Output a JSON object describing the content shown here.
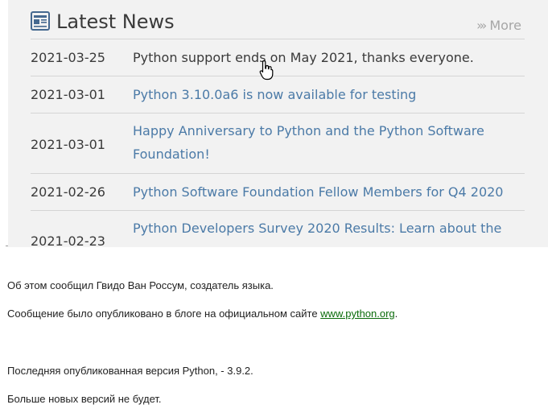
{
  "news": {
    "title": "Latest News",
    "more_label": "More",
    "items": [
      {
        "date": "2021-03-25",
        "title": "Python support ends on May 2021, thanks everyone."
      },
      {
        "date": "2021-03-01",
        "title": "Python 3.10.0a6 is now available for testing"
      },
      {
        "date": "2021-03-01",
        "title": "Happy Anniversary to Python and the Python Software Foundation!"
      },
      {
        "date": "2021-02-26",
        "title": "Python Software Foundation Fellow Members for Q4 2020"
      },
      {
        "date": "2021-02-23",
        "title": "Python Developers Survey 2020 Results: Learn about the"
      }
    ]
  },
  "article": {
    "p1": "Об этом сообщил Гвидо Ван Россум, создатель языка.",
    "p2_prefix": "Сообщение было опубликовано в блоге на официальном сайте ",
    "p2_link": "www.python.org",
    "p2_suffix": ".",
    "p3": "Последняя опубликованная версия Python, - 3.9.2.",
    "p4": "Больше новых версий не будет."
  },
  "colors": {
    "link_blue": "#4b7aa7",
    "text_dark": "#3a3a3a",
    "panel_bg": "#f2f2f2",
    "link_green": "#0a6b0a"
  },
  "icons": {
    "header": "newspaper-icon",
    "more": "chevrons-right-icon",
    "cursor": "hand-pointer-icon"
  }
}
